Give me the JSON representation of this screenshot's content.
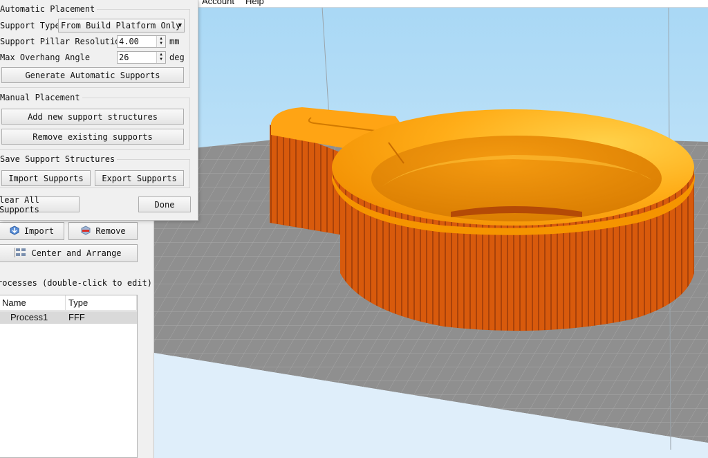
{
  "menubar": {
    "items": [
      "Account",
      "Help"
    ]
  },
  "support_dialog": {
    "automatic": {
      "title": "Automatic Placement",
      "support_type_label": "Support Type",
      "support_type_value": "From Build Platform Only",
      "pillar_label": "Support Pillar Resolution",
      "pillar_value": "4.00",
      "pillar_unit": "mm",
      "overhang_label": "Max Overhang Angle",
      "overhang_value": "26",
      "overhang_unit": "deg",
      "generate_label": "Generate Automatic Supports"
    },
    "manual": {
      "title": "Manual Placement",
      "add_label": "Add new support structures",
      "remove_label": "Remove existing supports"
    },
    "save": {
      "title": "Save Support Structures",
      "import_label": "Import Supports",
      "export_label": "Export Supports"
    },
    "clear_label": "lear All Supports",
    "done_label": "Done"
  },
  "left_panel": {
    "import_label": "Import",
    "remove_label": "Remove",
    "center_label": "Center and Arrange",
    "processes_label": "rocesses (double-click to edit)",
    "table": {
      "headers": [
        "Name",
        "Type"
      ],
      "rows": [
        {
          "name": "Process1",
          "type": "FFF"
        }
      ]
    }
  },
  "colors": {
    "model_top": "#ffa810",
    "support": "#e0600e",
    "bed": "#8e8e8e",
    "sky": "#a9d8f5"
  }
}
